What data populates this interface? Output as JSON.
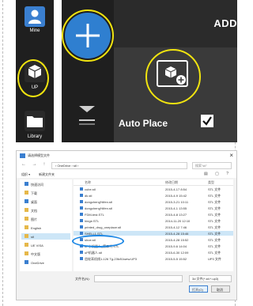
{
  "sidebar": {
    "mine_label": "Mine",
    "up_label": "UP",
    "library_label": "Library"
  },
  "toolbar": {
    "add_label": "ADD"
  },
  "add_panel": {
    "auto_place_label": "Auto Place",
    "auto_place_checked": true
  },
  "file_dialog": {
    "title": "请选择模型文件",
    "breadcrumb": "› OneDrive › stl ›",
    "search_placeholder": "搜索\"stl\"",
    "organize_label": "组织 ▾",
    "new_folder_label": "新建文件夹",
    "columns": [
      "名称",
      "修改日期",
      "类型"
    ],
    "nav_items": [
      {
        "label": "快速访问",
        "type": "star"
      },
      {
        "label": "下载",
        "type": "folder"
      },
      {
        "label": "桌面",
        "type": "blue"
      },
      {
        "label": "文档",
        "type": "folder"
      },
      {
        "label": "图片",
        "type": "folder"
      },
      {
        "label": "English",
        "type": "folder"
      },
      {
        "label": "stl",
        "type": "folder",
        "selected": true
      },
      {
        "label": "UE VISA",
        "type": "folder"
      },
      {
        "label": "中文版",
        "type": "folder"
      },
      {
        "label": "OneDrive",
        "type": "blue"
      }
    ],
    "files": [
      {
        "name": "cube.stl",
        "date": "2015-4-17 8:54",
        "type": "STL 文件"
      },
      {
        "name": "dk.stl",
        "date": "2015-4-9 15:42",
        "type": "STL 文件"
      },
      {
        "name": "dongcheng%lfen.stl",
        "date": "2015-3-21 10:11",
        "type": "STL 文件"
      },
      {
        "name": "dongcheng%lfen.stl",
        "date": "2015-4-1 13:55",
        "type": "STL 文件"
      },
      {
        "name": "FDM-test.STL",
        "date": "2015-4-8 13:27",
        "type": "STL 文件"
      },
      {
        "name": "hinge.STL",
        "date": "2014-11-20 12:10",
        "type": "STL 文件"
      },
      {
        "name": "printed_drug_oneplace.stl",
        "date": "2015-4-12 7:46",
        "type": "STL 文件"
      },
      {
        "name": "SHELL1.STL",
        "date": "2015-4-28 15:46",
        "type": "STL 文件",
        "selected": true
      },
      {
        "name": "shoe.stl",
        "date": "2015-4-28 15:52",
        "type": "STL 文件"
      },
      {
        "name": "uP小机器人_第二代.STL",
        "date": "2015-9-6 14:04",
        "type": "STL 文件"
      },
      {
        "name": "uP机器人.stl",
        "date": "2015-6-30 12:09",
        "type": "STL 文件"
      },
      {
        "name": "齿轮耳机线1-126 Tg-23fz51wew.UP3",
        "date": "2015-5-5 15:52",
        "type": "UP3 文件"
      }
    ],
    "filename_label": "文件名(N):",
    "filetype_value": "3d 文件(*.stl;*.up3)",
    "open_label": "打开(O)",
    "cancel_label": "取消"
  }
}
